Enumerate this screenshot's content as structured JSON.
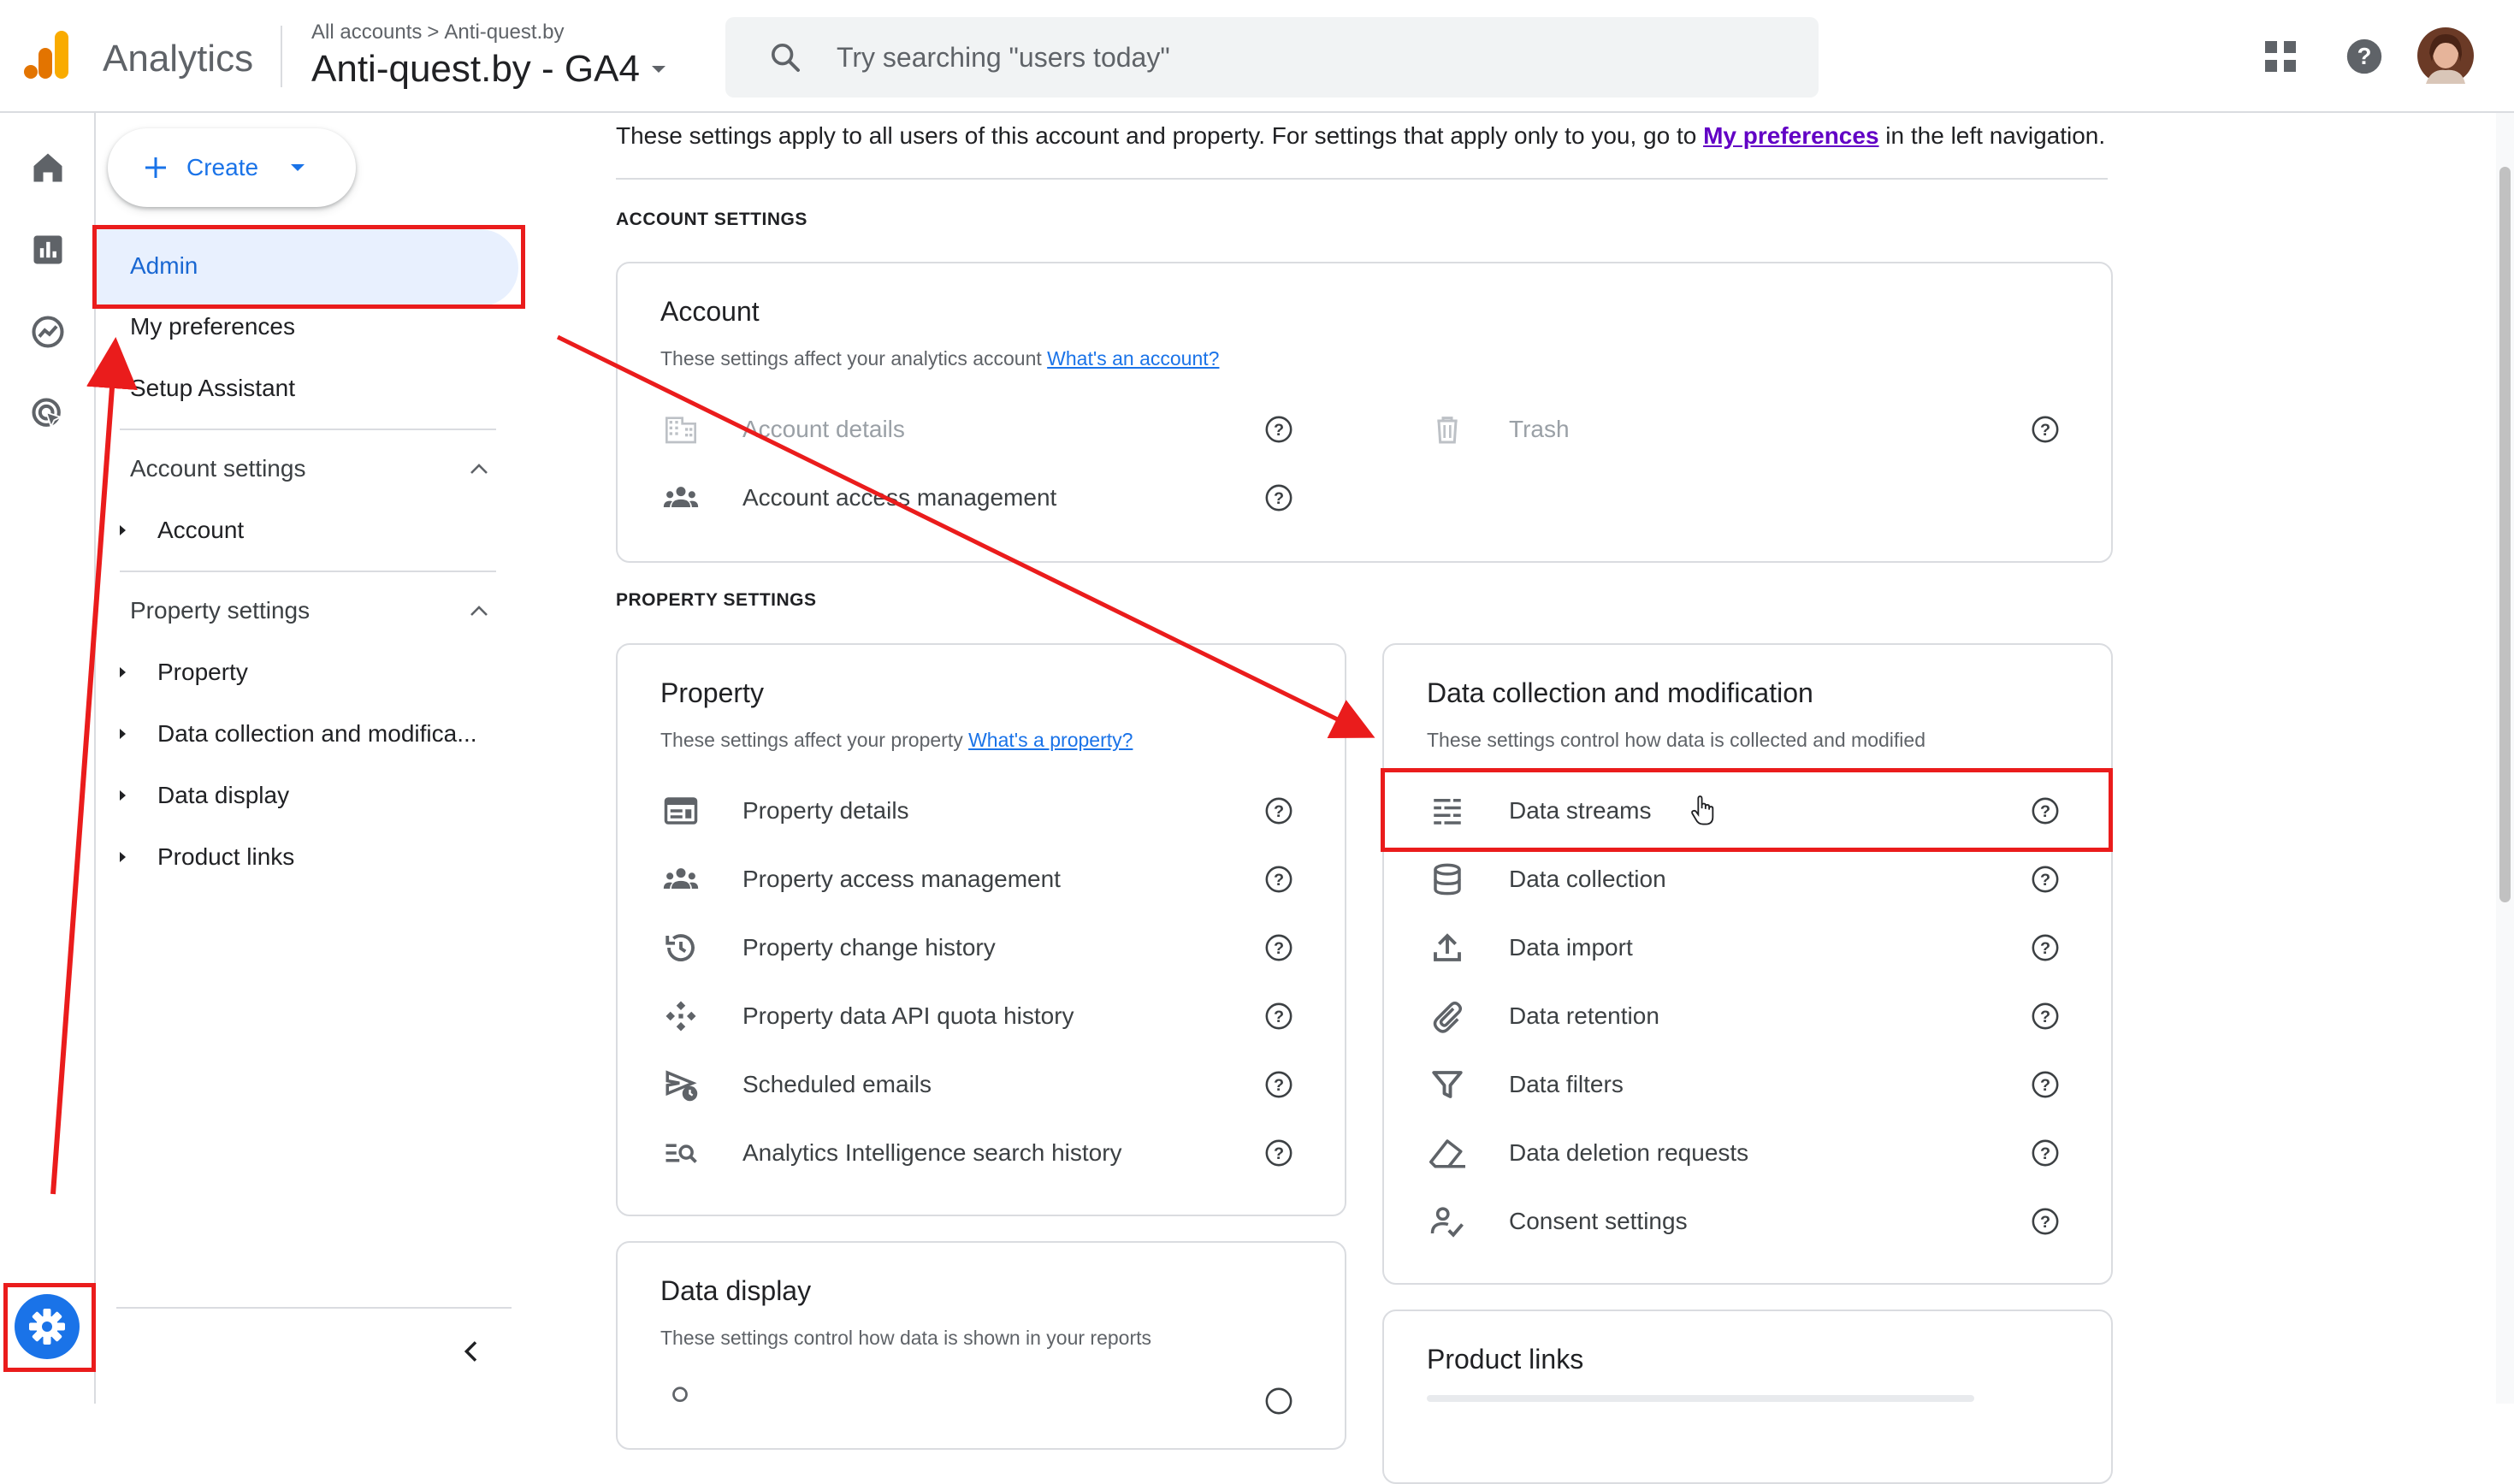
{
  "header": {
    "app_name": "Analytics",
    "breadcrumb_all": "All accounts",
    "breadcrumb_sep": ">",
    "breadcrumb_account": "Anti-quest.by",
    "property_name": "Anti-quest.by - GA4",
    "search_placeholder": "Try searching \"users today\"",
    "logo_colors": [
      "#f9ab00",
      "#e37400"
    ]
  },
  "rail": {
    "items": [
      "home-icon",
      "reports-icon",
      "explore-icon",
      "advertising-icon"
    ],
    "admin_icon": "gear-icon",
    "accent": "#1a73e8"
  },
  "nav": {
    "create_label": "Create",
    "admin": "Admin",
    "my_preferences": "My preferences",
    "setup_assistant": "Setup Assistant",
    "account_settings": "Account settings",
    "account": "Account",
    "property_settings": "Property settings",
    "property": "Property",
    "data_collection": "Data collection and modifica...",
    "data_display": "Data display",
    "product_links": "Product links"
  },
  "main": {
    "intro_before": "These settings apply to all users of this account and property. For settings that apply only to you, go to ",
    "intro_link": "My preferences",
    "intro_after": " in the left navigation.",
    "account_settings_label": "ACCOUNT SETTINGS",
    "property_settings_label": "PROPERTY SETTINGS",
    "account_card": {
      "title": "Account",
      "desc": "These settings affect your analytics account ",
      "desc_link": "What's an account?",
      "account_details": "Account details",
      "trash": "Trash",
      "access_mgmt": "Account access management"
    },
    "property_card": {
      "title": "Property",
      "desc": "These settings affect your property ",
      "desc_link": "What's a property?",
      "rows": [
        "Property details",
        "Property access management",
        "Property change history",
        "Property data API quota history",
        "Scheduled emails",
        "Analytics Intelligence search history"
      ]
    },
    "data_card": {
      "title": "Data collection and modification",
      "desc": "These settings control how data is collected and modified",
      "rows": [
        "Data streams",
        "Data collection",
        "Data import",
        "Data retention",
        "Data filters",
        "Data deletion requests",
        "Consent settings"
      ]
    },
    "display_card": {
      "title": "Data display",
      "desc": "These settings control how data is shown in your reports"
    },
    "links_card": {
      "title": "Product links"
    }
  },
  "annotations": {
    "highlight_color": "#ea1c1c"
  }
}
